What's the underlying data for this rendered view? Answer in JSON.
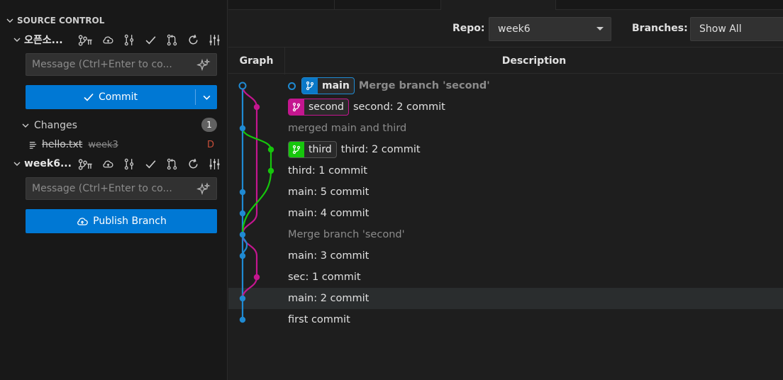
{
  "sidebar": {
    "section_title": "SOURCE CONTROL",
    "repos": [
      {
        "name": "오픈소...",
        "branch_label": "ᵖπ",
        "message_placeholder": "Message (Ctrl+Enter to co...",
        "commit_label": "Commit",
        "changes": {
          "label": "Changes",
          "count": "1",
          "files": [
            {
              "name": "hello.txt",
              "dir": "week3",
              "status": "D"
            }
          ]
        }
      },
      {
        "name": "week6...",
        "branch_label": "ᵖπ",
        "message_placeholder": "Message (Ctrl+Enter to co...",
        "publish_label": "Publish Branch"
      }
    ]
  },
  "main": {
    "filters": {
      "repo_label": "Repo:",
      "repo_value": "week6",
      "branches_label": "Branches:",
      "branches_value": "Show All"
    },
    "table": {
      "col_graph": "Graph",
      "col_description": "Description"
    },
    "commits": [
      {
        "refs": [
          {
            "name": "main",
            "kind": "main"
          }
        ],
        "message": "Merge branch 'second'",
        "style": "dim-bold",
        "head": true
      },
      {
        "refs": [
          {
            "name": "second",
            "kind": "second"
          }
        ],
        "message": "second: 2 commit",
        "style": "normal"
      },
      {
        "refs": [],
        "message": "merged main and third",
        "style": "dim"
      },
      {
        "refs": [
          {
            "name": "third",
            "kind": "third"
          }
        ],
        "message": "third: 2 commit",
        "style": "normal"
      },
      {
        "refs": [],
        "message": "third: 1 commit",
        "style": "normal"
      },
      {
        "refs": [],
        "message": "main: 5 commit",
        "style": "normal"
      },
      {
        "refs": [],
        "message": "main: 4 commit",
        "style": "normal"
      },
      {
        "refs": [],
        "message": "Merge branch 'second'",
        "style": "dim"
      },
      {
        "refs": [],
        "message": "main: 3 commit",
        "style": "normal"
      },
      {
        "refs": [],
        "message": "sec: 1 commit",
        "style": "normal"
      },
      {
        "refs": [],
        "message": "main: 2 commit",
        "style": "normal",
        "highlight": true
      },
      {
        "refs": [],
        "message": "first commit",
        "style": "normal"
      }
    ],
    "colors": {
      "main": "#1f8ad2",
      "second": "#c4168f",
      "third": "#16c60c"
    }
  }
}
